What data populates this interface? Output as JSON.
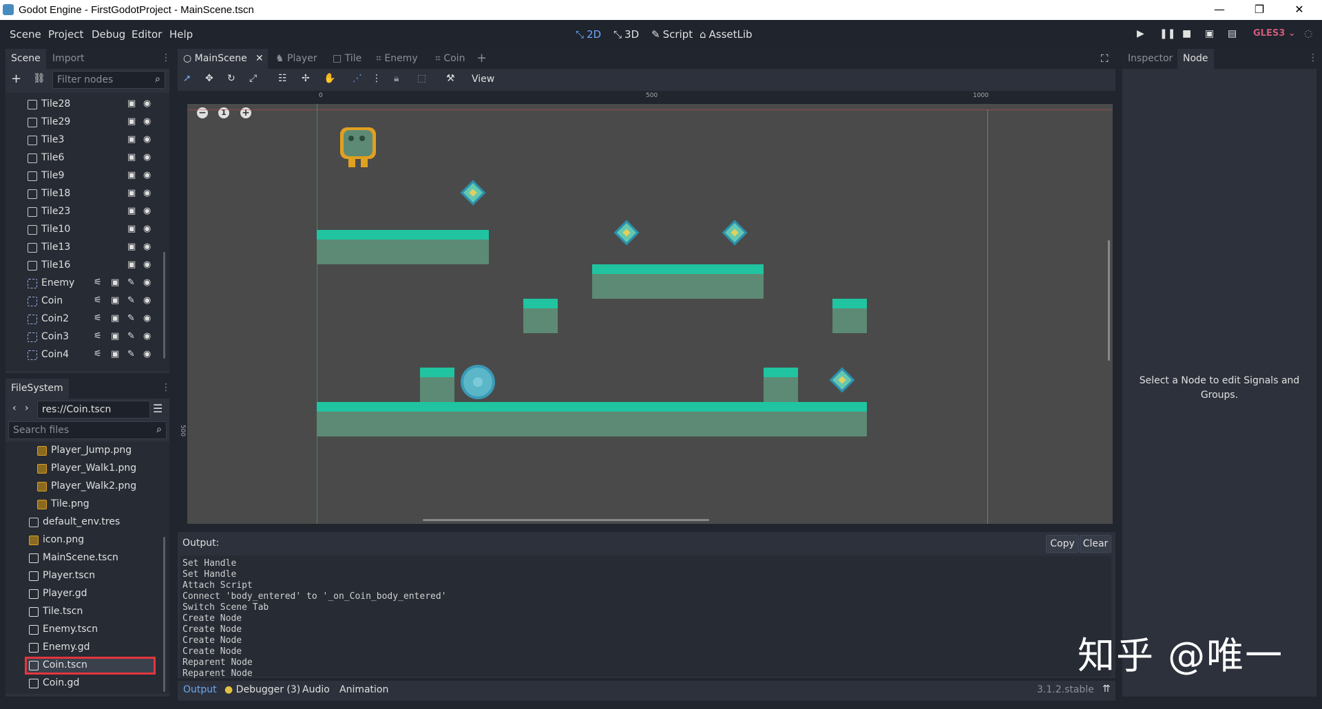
{
  "window": {
    "title": "Godot Engine - FirstGodotProject - MainScene.tscn",
    "controls": [
      "—",
      "❐",
      "✕"
    ]
  },
  "menu": {
    "items": [
      "Scene",
      "Project",
      "Debug",
      "Editor",
      "Help"
    ],
    "modes": [
      {
        "label": "2D",
        "icon": "2d-icon",
        "active": true
      },
      {
        "label": "3D",
        "icon": "3d-icon",
        "active": false
      },
      {
        "label": "Script",
        "icon": "script-icon",
        "active": false
      },
      {
        "label": "AssetLib",
        "icon": "assetlib-icon",
        "active": false
      }
    ],
    "renderer": "GLES3"
  },
  "scene_dock": {
    "tabs": [
      "Scene",
      "Import"
    ],
    "filter_placeholder": "Filter nodes",
    "nodes": [
      {
        "name": "Tile28",
        "type": "instance"
      },
      {
        "name": "Tile29",
        "type": "instance"
      },
      {
        "name": "Tile3",
        "type": "instance"
      },
      {
        "name": "Tile6",
        "type": "instance"
      },
      {
        "name": "Tile9",
        "type": "instance"
      },
      {
        "name": "Tile18",
        "type": "instance"
      },
      {
        "name": "Tile23",
        "type": "instance"
      },
      {
        "name": "Tile10",
        "type": "instance"
      },
      {
        "name": "Tile13",
        "type": "instance"
      },
      {
        "name": "Tile16",
        "type": "instance"
      },
      {
        "name": "Enemy",
        "type": "area"
      },
      {
        "name": "Coin",
        "type": "area"
      },
      {
        "name": "Coin2",
        "type": "area"
      },
      {
        "name": "Coin3",
        "type": "area"
      },
      {
        "name": "Coin4",
        "type": "area"
      }
    ]
  },
  "filesystem_dock": {
    "title": "FileSystem",
    "path": "res://Coin.tscn",
    "search_placeholder": "Search files",
    "files": [
      {
        "name": "Player_Jump.png",
        "kind": "image-icon",
        "indent": 2
      },
      {
        "name": "Player_Walk1.png",
        "kind": "image-icon",
        "indent": 2
      },
      {
        "name": "Player_Walk2.png",
        "kind": "image-icon",
        "indent": 2
      },
      {
        "name": "Tile.png",
        "kind": "image-icon",
        "indent": 2
      },
      {
        "name": "default_env.tres",
        "kind": "env-icon",
        "indent": 1
      },
      {
        "name": "icon.png",
        "kind": "image-icon",
        "indent": 1
      },
      {
        "name": "MainScene.tscn",
        "kind": "scene-icon",
        "indent": 1
      },
      {
        "name": "Player.tscn",
        "kind": "scene-icon",
        "indent": 1
      },
      {
        "name": "Player.gd",
        "kind": "gear-icon",
        "indent": 1
      },
      {
        "name": "Tile.tscn",
        "kind": "scene-icon",
        "indent": 1
      },
      {
        "name": "Enemy.tscn",
        "kind": "scene-icon",
        "indent": 1
      },
      {
        "name": "Enemy.gd",
        "kind": "gear-icon",
        "indent": 1
      },
      {
        "name": "Coin.tscn",
        "kind": "scene-icon",
        "indent": 1,
        "selected": true
      },
      {
        "name": "Coin.gd",
        "kind": "gear-icon",
        "indent": 1
      }
    ]
  },
  "editor_tabs": [
    "MainScene",
    "Player",
    "Tile",
    "Enemy",
    "Coin"
  ],
  "toolbar": {
    "view_label": "View"
  },
  "ruler": {
    "marks": [
      "0",
      "500",
      "1000"
    ],
    "left_mark": "500"
  },
  "zoom": {
    "minus": "−",
    "reset": "1",
    "plus": "+"
  },
  "output": {
    "title": "Output:",
    "copy_label": "Copy",
    "clear_label": "Clear",
    "lines": [
      "Set Handle",
      "Set Handle",
      "Attach Script",
      "Connect 'body_entered' to '_on_Coin_body_entered'",
      "Switch Scene Tab",
      "Create Node",
      "Create Node",
      "Create Node",
      "Create Node",
      "Reparent Node",
      "Reparent Node"
    ]
  },
  "bottom_tabs": [
    "Output",
    "Debugger (3)",
    "Audio",
    "Animation"
  ],
  "version": "3.1.2.stable",
  "inspector": {
    "tabs": [
      "Inspector",
      "Node"
    ],
    "hint": "Select a Node to edit Signals and Groups."
  },
  "watermark": "知乎 @唯一",
  "colors": {
    "accent": "#6fa8f5",
    "selection_outline": "#e5363d",
    "renderer": "#d25a7a",
    "tile_grass": "#20c4a0",
    "tile_body": "#5d8a74"
  }
}
